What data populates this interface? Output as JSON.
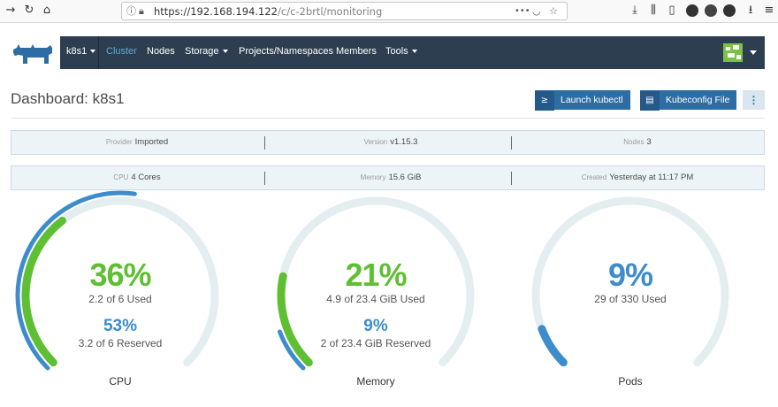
{
  "browser": {
    "url_host": "https://192.168.194.122",
    "url_path": "/c/c-2brtl/monitoring",
    "menu_dots": "•••"
  },
  "nav": {
    "cluster_select": "k8s1",
    "items": [
      "Cluster",
      "Nodes",
      "Storage",
      "Projects/Namespaces",
      "Members",
      "Tools"
    ]
  },
  "header": {
    "title": "Dashboard: k8s1",
    "launch_kubectl": "Launch kubectl",
    "kubeconfig_file": "Kubeconfig File",
    "more": "⋮"
  },
  "info_row1": [
    {
      "label": "Provider",
      "value": "Imported"
    },
    {
      "label": "Version",
      "value": "v1.15.3"
    },
    {
      "label": "Nodes",
      "value": "3"
    }
  ],
  "info_row2": [
    {
      "label": "CPU",
      "value": "4 Cores"
    },
    {
      "label": "Memory",
      "value": "15.6 GiB"
    },
    {
      "label": "Created",
      "value": "Yesterday at 11:17 PM"
    }
  ],
  "gauges": [
    {
      "title": "CPU",
      "used_pct": "36%",
      "used_text": "2.2 of 6 Used",
      "reserved_pct": "53%",
      "reserved_text": "3.2 of 6 Reserved",
      "used_fraction": 0.36,
      "reserved_fraction": 0.53
    },
    {
      "title": "Memory",
      "used_pct": "21%",
      "used_text": "4.9 of 23.4 GiB Used",
      "reserved_pct": "9%",
      "reserved_text": "2 of 23.4 GiB Reserved",
      "used_fraction": 0.21,
      "reserved_fraction": 0.09
    },
    {
      "title": "Pods",
      "used_pct": "9%",
      "used_text": "29 of 330 Used",
      "used_fraction": 0.09
    }
  ],
  "colors": {
    "nav_bg": "#2d3e50",
    "accent_blue": "#3d8ccb",
    "accent_green": "#5fbf32",
    "track": "#e4eef1"
  }
}
